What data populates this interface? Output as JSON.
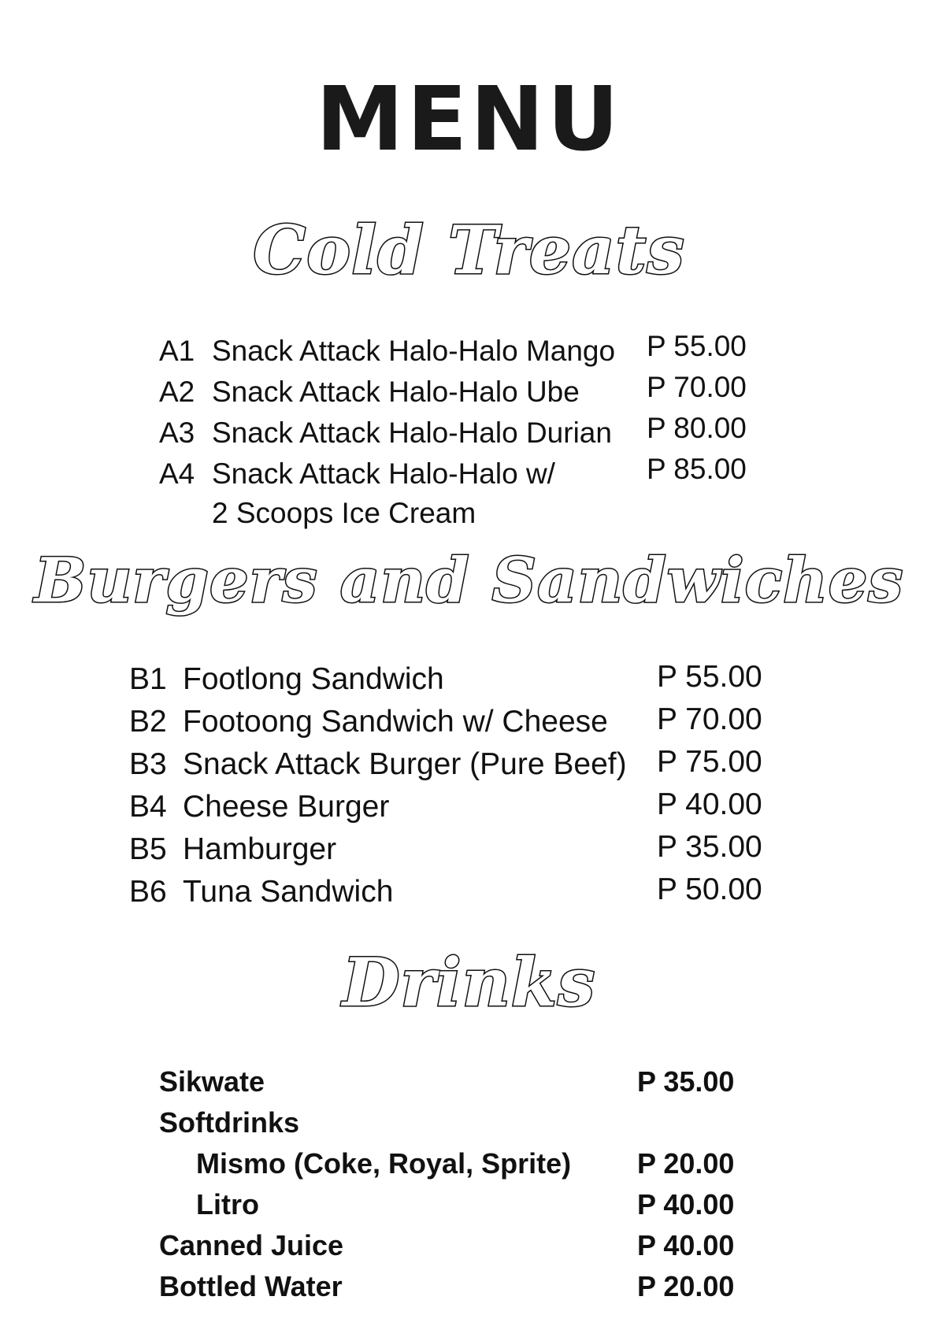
{
  "title": "MENU",
  "sections": {
    "cold_treats": {
      "heading": "Cold Treats",
      "items": [
        {
          "code": "A1",
          "name": "Snack Attack Halo-Halo Mango",
          "price": "P  55.00"
        },
        {
          "code": "A2",
          "name": "Snack Attack Halo-Halo Ube",
          "price": "P  70.00"
        },
        {
          "code": "A3",
          "name": "Snack Attack Halo-Halo Durian",
          "price": "P  80.00"
        },
        {
          "code": "A4",
          "name": "Snack Attack Halo-Halo w/",
          "name_cont": "2 Scoops Ice Cream",
          "price": "P  85.00"
        }
      ]
    },
    "burgers": {
      "heading": "Burgers and Sandwiches",
      "items": [
        {
          "code": "B1",
          "name": "Footlong Sandwich",
          "price": "P  55.00"
        },
        {
          "code": "B2",
          "name": "Footoong Sandwich w/ Cheese",
          "price": "P  70.00"
        },
        {
          "code": "B3",
          "name": "Snack Attack Burger (Pure Beef)",
          "price": "P  75.00"
        },
        {
          "code": "B4",
          "name": "Cheese Burger",
          "price": "P  40.00"
        },
        {
          "code": "B5",
          "name": "Hamburger",
          "price": "P  35.00"
        },
        {
          "code": "B6",
          "name": "Tuna Sandwich",
          "price": "P  50.00"
        }
      ]
    },
    "drinks": {
      "heading": "Drinks",
      "items": [
        {
          "name": "Sikwate",
          "price": "P  35.00"
        },
        {
          "name": "Softdrinks",
          "price": ""
        },
        {
          "name": "Mismo (Coke, Royal, Sprite)",
          "price": "P  20.00"
        },
        {
          "name": "Litro",
          "price": "P  40.00"
        },
        {
          "name": "Canned Juice",
          "price": "P  40.00"
        },
        {
          "name": "Bottled Water",
          "price": "P  20.00"
        }
      ]
    }
  }
}
